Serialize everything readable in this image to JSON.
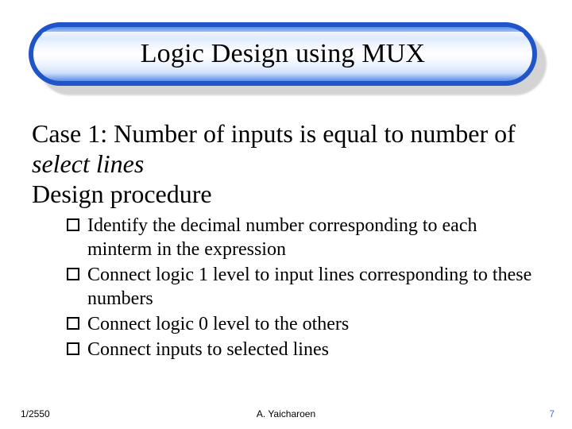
{
  "title": "Logic Design using MUX",
  "case_prefix": "Case 1: Number of inputs is equal to number of ",
  "case_italic": "select lines",
  "design_line": "Design procedure",
  "bullets": [
    "Identify the decimal number corresponding to each minterm in the expression",
    "Connect logic 1 level to input lines corresponding to these numbers",
    "Connect logic 0 level to the others",
    "Connect inputs to selected lines"
  ],
  "footer": {
    "date": "1/2550",
    "author": "A. Yaicharoen",
    "page": "7"
  }
}
